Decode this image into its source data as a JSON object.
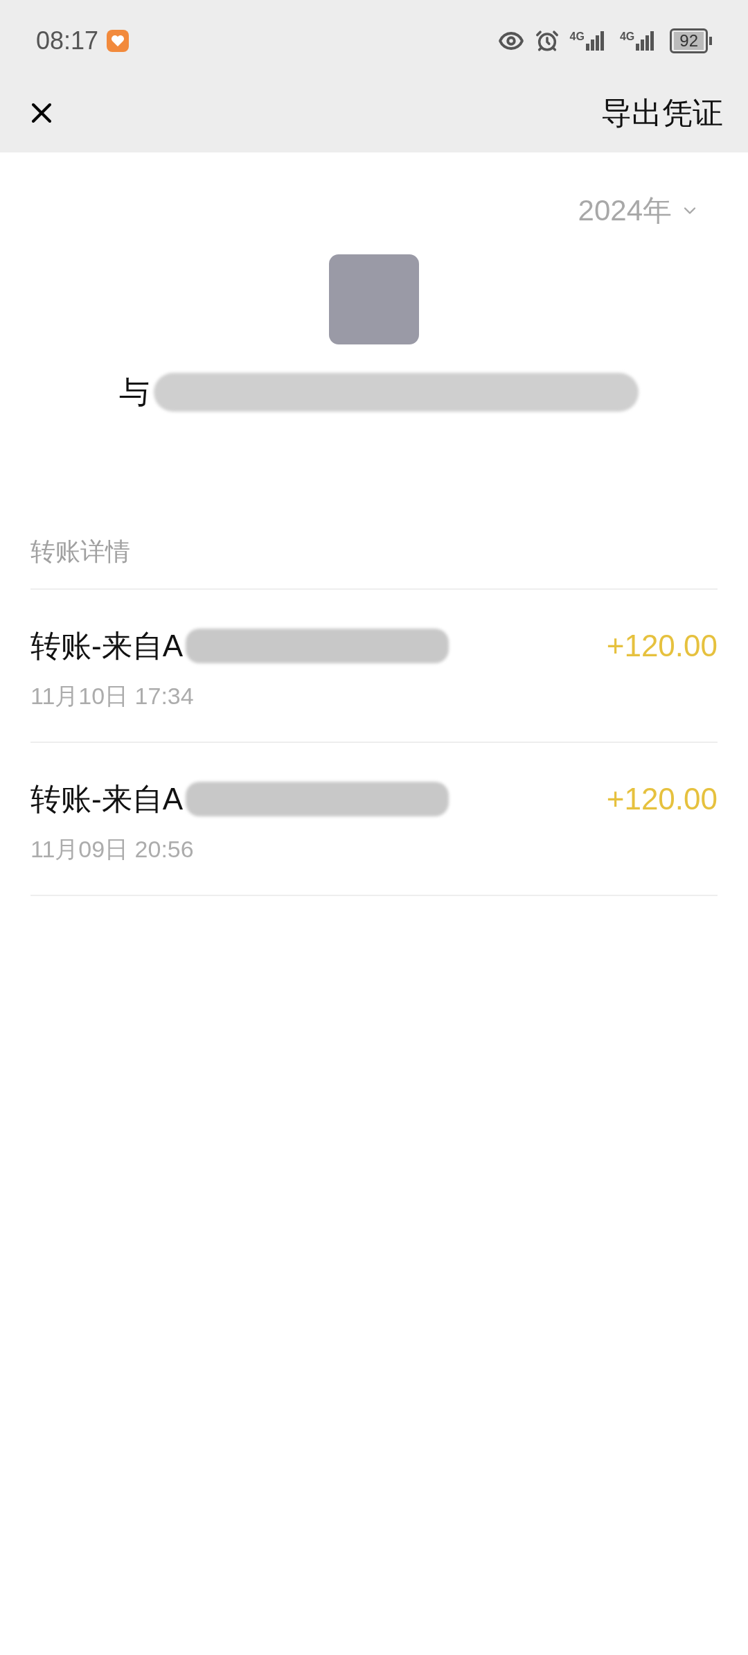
{
  "status_bar": {
    "time": "08:17",
    "network_1": "4G",
    "network_2": "4G",
    "battery": "92"
  },
  "header": {
    "action": "导出凭证"
  },
  "year_filter": {
    "label": "2024年"
  },
  "contact": {
    "title_visible": "与"
  },
  "section": {
    "title": "转账详情"
  },
  "transactions": [
    {
      "title": "转账-来自A",
      "time": "11月10日 17:34",
      "amount": "+120.00"
    },
    {
      "title": "转账-来自A",
      "time": "11月09日 20:56",
      "amount": "+120.00"
    }
  ]
}
